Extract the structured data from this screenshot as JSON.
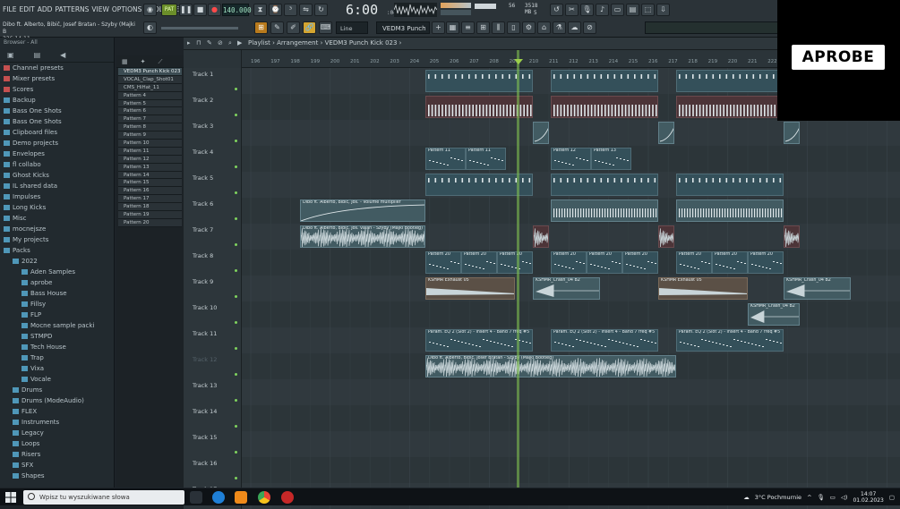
{
  "menu": [
    "FILE",
    "EDIT",
    "ADD",
    "PATTERNS",
    "VIEW",
    "OPTIONS",
    "TOOLS",
    "HELP"
  ],
  "song": {
    "title": "Dibo ft. Alberto, Bibič, Josef Bratan - Szyby (Majki B",
    "time": "226:14:11"
  },
  "transport": {
    "pat_label": "PAT",
    "tempo": "140.000",
    "clock": "6:00",
    "clock_sub": ":04",
    "cpu": "56",
    "ram": "3518 MB",
    "voices": "5"
  },
  "toolbar2": {
    "line_label": "Line",
    "pattern_name": "VEDM3 Punch Kick 023"
  },
  "browser": {
    "header": "Browser - All",
    "items": [
      {
        "label": "Channel presets",
        "icon": "preset-icon",
        "indent": 0
      },
      {
        "label": "Mixer presets",
        "icon": "preset-icon",
        "indent": 0
      },
      {
        "label": "Scores",
        "icon": "note-icon",
        "indent": 0
      },
      {
        "label": "Backup",
        "icon": "folder-icon",
        "indent": 0
      },
      {
        "label": "Bass One Shots",
        "icon": "folder-icon",
        "indent": 0
      },
      {
        "label": "Bass One Shots",
        "icon": "folder-icon",
        "indent": 0
      },
      {
        "label": "Clipboard files",
        "icon": "folder-icon",
        "indent": 0
      },
      {
        "label": "Demo projects",
        "icon": "folder-icon",
        "indent": 0
      },
      {
        "label": "Envelopes",
        "icon": "folder-icon",
        "indent": 0
      },
      {
        "label": "fl collabo",
        "icon": "folder-icon",
        "indent": 0
      },
      {
        "label": "Ghost Kicks",
        "icon": "folder-icon",
        "indent": 0
      },
      {
        "label": "IL shared data",
        "icon": "folder-icon",
        "indent": 0
      },
      {
        "label": "Impulses",
        "icon": "folder-icon",
        "indent": 0
      },
      {
        "label": "Long Kicks",
        "icon": "folder-icon",
        "indent": 0
      },
      {
        "label": "Misc",
        "icon": "folder-icon",
        "indent": 0
      },
      {
        "label": "mocnejsze",
        "icon": "folder-icon",
        "indent": 0
      },
      {
        "label": "My projects",
        "icon": "folder-icon",
        "indent": 0
      },
      {
        "label": "Packs",
        "icon": "folder-open-icon",
        "indent": 0
      },
      {
        "label": "2022",
        "icon": "folder-open-icon",
        "indent": 1
      },
      {
        "label": "Aden Samples",
        "icon": "folder-icon",
        "indent": 2
      },
      {
        "label": "aprobe",
        "icon": "folder-icon",
        "indent": 2
      },
      {
        "label": "Bass House",
        "icon": "folder-icon",
        "indent": 2
      },
      {
        "label": "Fillsy",
        "icon": "folder-icon",
        "indent": 2
      },
      {
        "label": "FLP",
        "icon": "folder-icon",
        "indent": 2
      },
      {
        "label": "Mocne sample packi",
        "icon": "folder-icon",
        "indent": 2
      },
      {
        "label": "STMPD",
        "icon": "folder-icon",
        "indent": 2
      },
      {
        "label": "Tech House",
        "icon": "folder-icon",
        "indent": 2
      },
      {
        "label": "Trap",
        "icon": "folder-icon",
        "indent": 2
      },
      {
        "label": "Vixa",
        "icon": "folder-icon",
        "indent": 2
      },
      {
        "label": "Vocale",
        "icon": "folder-icon",
        "indent": 2
      },
      {
        "label": "Drums",
        "icon": "folder-icon",
        "indent": 1
      },
      {
        "label": "Drums (ModeAudio)",
        "icon": "folder-icon",
        "indent": 1
      },
      {
        "label": "FLEX",
        "icon": "folder-icon",
        "indent": 1
      },
      {
        "label": "Instruments",
        "icon": "folder-icon",
        "indent": 1
      },
      {
        "label": "Legacy",
        "icon": "folder-icon",
        "indent": 1
      },
      {
        "label": "Loops",
        "icon": "folder-icon",
        "indent": 1
      },
      {
        "label": "Risers",
        "icon": "folder-icon",
        "indent": 1
      },
      {
        "label": "SFX",
        "icon": "folder-icon",
        "indent": 1
      },
      {
        "label": "Shapes",
        "icon": "folder-icon",
        "indent": 1
      }
    ]
  },
  "channels": [
    "VEDM3 Punch Kick 023",
    "VOCAL_Clap_Shot01",
    "CMS_HiHat_11",
    "Pattern 4",
    "Pattern 5",
    "Pattern 6",
    "Pattern 7",
    "Pattern 8",
    "Pattern 9",
    "Pattern 10",
    "Pattern 11",
    "Pattern 12",
    "Pattern 13",
    "Pattern 14",
    "Pattern 15",
    "Pattern 16",
    "Pattern 17",
    "Pattern 18",
    "Pattern 19",
    "Pattern 20"
  ],
  "playlist": {
    "breadcrumb": [
      "Playlist",
      "Arrangement",
      "VEDM3 Punch Kick 023"
    ],
    "ruler": [
      "196",
      "197",
      "198",
      "199",
      "200",
      "201",
      "202",
      "203",
      "204",
      "205",
      "206",
      "207",
      "208",
      "209",
      "210",
      "211",
      "212",
      "213",
      "214",
      "215",
      "216",
      "217",
      "218",
      "219",
      "220",
      "221",
      "222",
      "223",
      "224",
      "225",
      "226",
      "227"
    ],
    "tracks": [
      "Track 1",
      "Track 2",
      "Track 3",
      "Track 4",
      "Track 5",
      "Track 6",
      "Track 7",
      "Track 8",
      "Track 9",
      "Track 10",
      "Track 11",
      "Track 12",
      "Track 13",
      "Track 14",
      "Track 15",
      "Track 16",
      "Track 17"
    ],
    "clip_labels": {
      "pattern_11": "Pattern 11",
      "pattern_12": "Pattern 12",
      "pattern_13": "Pattern 13",
      "pattern_20": "Pattern 20",
      "volume": "Dibo ft. Alberto, Bibič, Jos. - Volume multiplier",
      "vocal": "Dibo ft. Alberto, Bibič, Jos. valan - Szyby (Majki Bootleg)",
      "exhaust": "KSHMR Exhaust 05",
      "crash": "KSHMR_Crash_04 B2",
      "param": "Param. EQ 2 (Slot 2) - Insert 4 - Band 7 freq #5",
      "full": "Dibo ft. Alberto, Bibič, Josef Bratan - Szyby (Majki Bootleg)"
    }
  },
  "overlay": {
    "text": "APROBE"
  },
  "taskbar": {
    "search_placeholder": "Wpisz tu wyszukiwane słowa",
    "weather": "3°C  Pochmurnie",
    "time": "14:07",
    "date": "01.02.2023"
  },
  "colors": {
    "accent_green": "#7ec94a",
    "playhead": "#7ebe50",
    "overlay_bg": "#000000"
  }
}
